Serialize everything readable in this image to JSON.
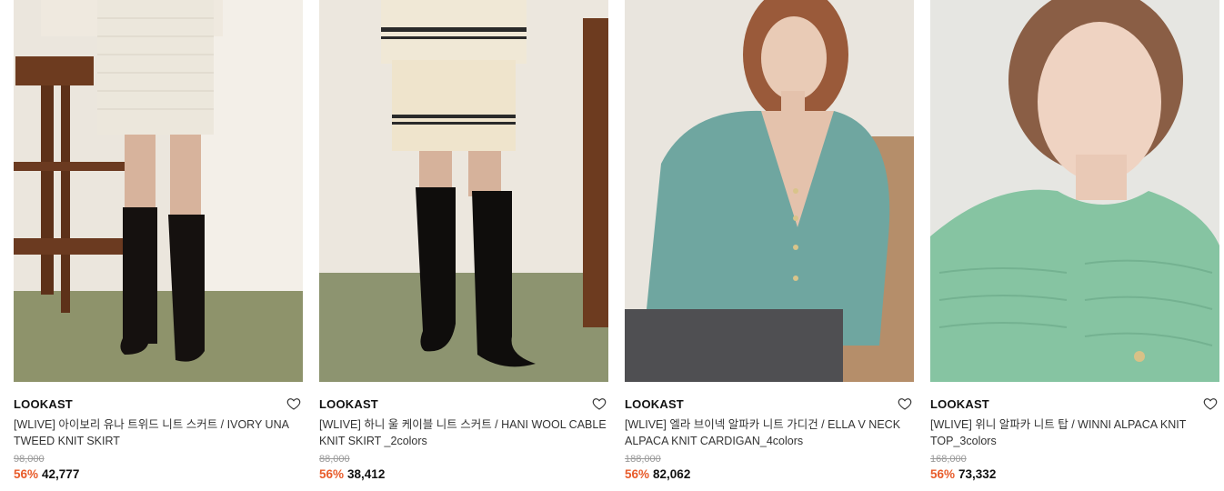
{
  "products": [
    {
      "brand": "LOOKAST",
      "title": "[WLIVE] 아이보리 유나 트위드 니트 스커트 / IVORY UNA TWEED KNIT SKIRT",
      "original_price": "98,000",
      "discount": "56%",
      "price": "42,777",
      "image_icon": "photo-skirt-ivory"
    },
    {
      "brand": "LOOKAST",
      "title": "[WLIVE] 하니 울 케이블 니트 스커트 / HANI WOOL CABLE KNIT SKIRT _2colors",
      "original_price": "88,000",
      "discount": "56%",
      "price": "38,412",
      "image_icon": "photo-skirt-cable"
    },
    {
      "brand": "LOOKAST",
      "title": "[WLIVE] 엘라 브이넥 알파카 니트 가디건 / ELLA V NECK ALPACA KNIT CARDIGAN_4colors",
      "original_price": "188,000",
      "discount": "56%",
      "price": "82,062",
      "image_icon": "photo-cardigan-mint"
    },
    {
      "brand": "LOOKAST",
      "title": "[WLIVE] 위니 알파카 니트 탑 / WINNI ALPACA KNIT TOP_3colors",
      "original_price": "168,000",
      "discount": "56%",
      "price": "73,332",
      "image_icon": "photo-knit-top-mint"
    }
  ],
  "colors": {
    "discount": "#e85c2b",
    "brand_text": "#111111",
    "strike_price": "#9a9a9a"
  }
}
